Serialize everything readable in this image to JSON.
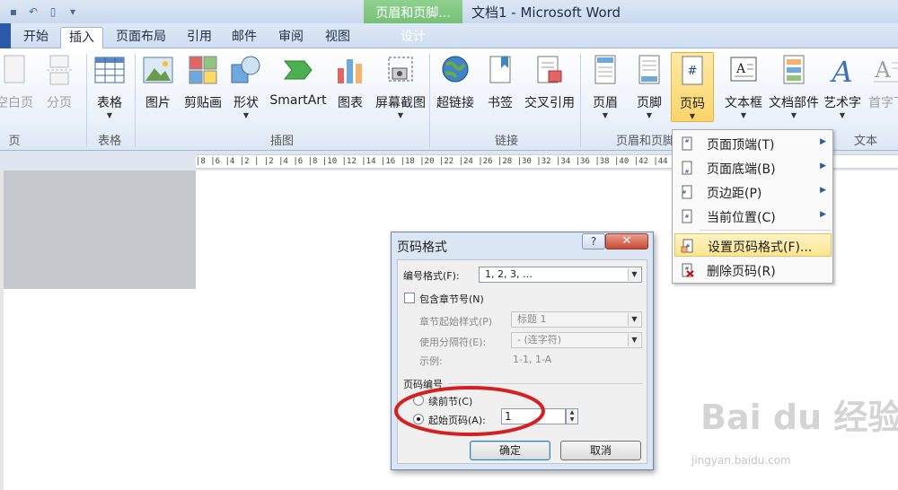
{
  "window": {
    "title": "文档1 - Microsoft Word",
    "context_group": "页眉和页脚...",
    "tabs": [
      {
        "label": "开始"
      },
      {
        "label": "插入"
      },
      {
        "label": "页面布局"
      },
      {
        "label": "引用"
      },
      {
        "label": "邮件"
      },
      {
        "label": "审阅"
      },
      {
        "label": "视图"
      },
      {
        "label": "设计"
      }
    ]
  },
  "ribbon": {
    "buttons": [
      {
        "label": "空白页",
        "icon": "blank-page-icon",
        "enabled": false
      },
      {
        "label": "分页",
        "icon": "page-break-icon",
        "enabled": false
      },
      {
        "label": "表格",
        "icon": "table-icon",
        "enabled": true
      },
      {
        "label": "图片",
        "icon": "picture-icon",
        "enabled": true
      },
      {
        "label": "剪贴画",
        "icon": "clip-art-icon",
        "enabled": true
      },
      {
        "label": "形状",
        "icon": "shapes-icon",
        "enabled": true
      },
      {
        "label": "SmartArt",
        "icon": "smartart-icon",
        "enabled": true
      },
      {
        "label": "图表",
        "icon": "chart-icon",
        "enabled": true
      },
      {
        "label": "屏幕截图",
        "icon": "screenshot-icon",
        "enabled": true
      },
      {
        "label": "超链接",
        "icon": "hyperlink-globe-icon",
        "enabled": true
      },
      {
        "label": "书签",
        "icon": "bookmark-icon",
        "enabled": true
      },
      {
        "label": "交叉引用",
        "icon": "cross-reference-icon",
        "enabled": true
      },
      {
        "label": "页眉",
        "icon": "header-icon",
        "enabled": true
      },
      {
        "label": "页脚",
        "icon": "footer-icon",
        "enabled": true
      },
      {
        "label": "页码",
        "icon": "page-number-icon",
        "enabled": true
      },
      {
        "label": "文本框",
        "icon": "text-box-icon",
        "enabled": true
      },
      {
        "label": "文档部件",
        "icon": "quick-parts-icon",
        "enabled": true
      },
      {
        "label": "艺术字",
        "icon": "wordart-icon",
        "enabled": true
      },
      {
        "label": "首字下",
        "icon": "drop-cap-icon",
        "enabled": false
      }
    ],
    "groups": [
      "页",
      "表格",
      "插图",
      "链接",
      "页眉和页脚",
      "文本"
    ]
  },
  "ruler": {
    "text": "|8 |6 |4 |2 |  |2 |4 |6 |8 |10 |12 |14 |16 |18 |20 |22 |24 |26 |28 |30 |32 |34 |36 |38 |40 |42 |44 |46"
  },
  "menu": {
    "items": [
      {
        "label": "页面顶端(T)",
        "icon": "page-top-icon",
        "submenu": "▶"
      },
      {
        "label": "页面底端(B)",
        "icon": "page-bottom-icon",
        "submenu": "▶"
      },
      {
        "label": "页边距(P)",
        "icon": "page-margin-icon",
        "submenu": "▶"
      },
      {
        "label": "当前位置(C)",
        "icon": "current-position-icon",
        "submenu": "▶"
      },
      {
        "label": "设置页码格式(F)...",
        "icon": "format-page-number-icon",
        "submenu": ""
      },
      {
        "label": "删除页码(R)",
        "icon": "remove-page-number-icon",
        "submenu": ""
      }
    ]
  },
  "dialog": {
    "title": "页码格式",
    "help": "?",
    "close": "✕",
    "number_format_label": "编号格式(F):",
    "number_format_value": "1, 2, 3, …",
    "include_chapter_label": "包含章节号(N)",
    "include_chapter_checked": false,
    "chapter_style_label": "章节起始样式(P)",
    "chapter_style_value": "标题 1",
    "separator_label": "使用分隔符(E):",
    "separator_value": "-  (连字符)",
    "example_label": "示例:",
    "example_value": "1-1, 1-A",
    "section_label": "页码编号",
    "continue_label": "续前节(C)",
    "start_at_label": "起始页码(A):",
    "start_at_value": "1",
    "selected_option": "start_at",
    "ok_label": "确定",
    "cancel_label": "取消"
  },
  "watermark": {
    "main": "Bai du 经验",
    "url": "jingyan.baidu.com"
  },
  "colors": {
    "accent_blue": "#2a5aa8",
    "context_green": "#5fb160",
    "highlight_gold": "#fbd46b",
    "annotation_red": "#d42020"
  }
}
